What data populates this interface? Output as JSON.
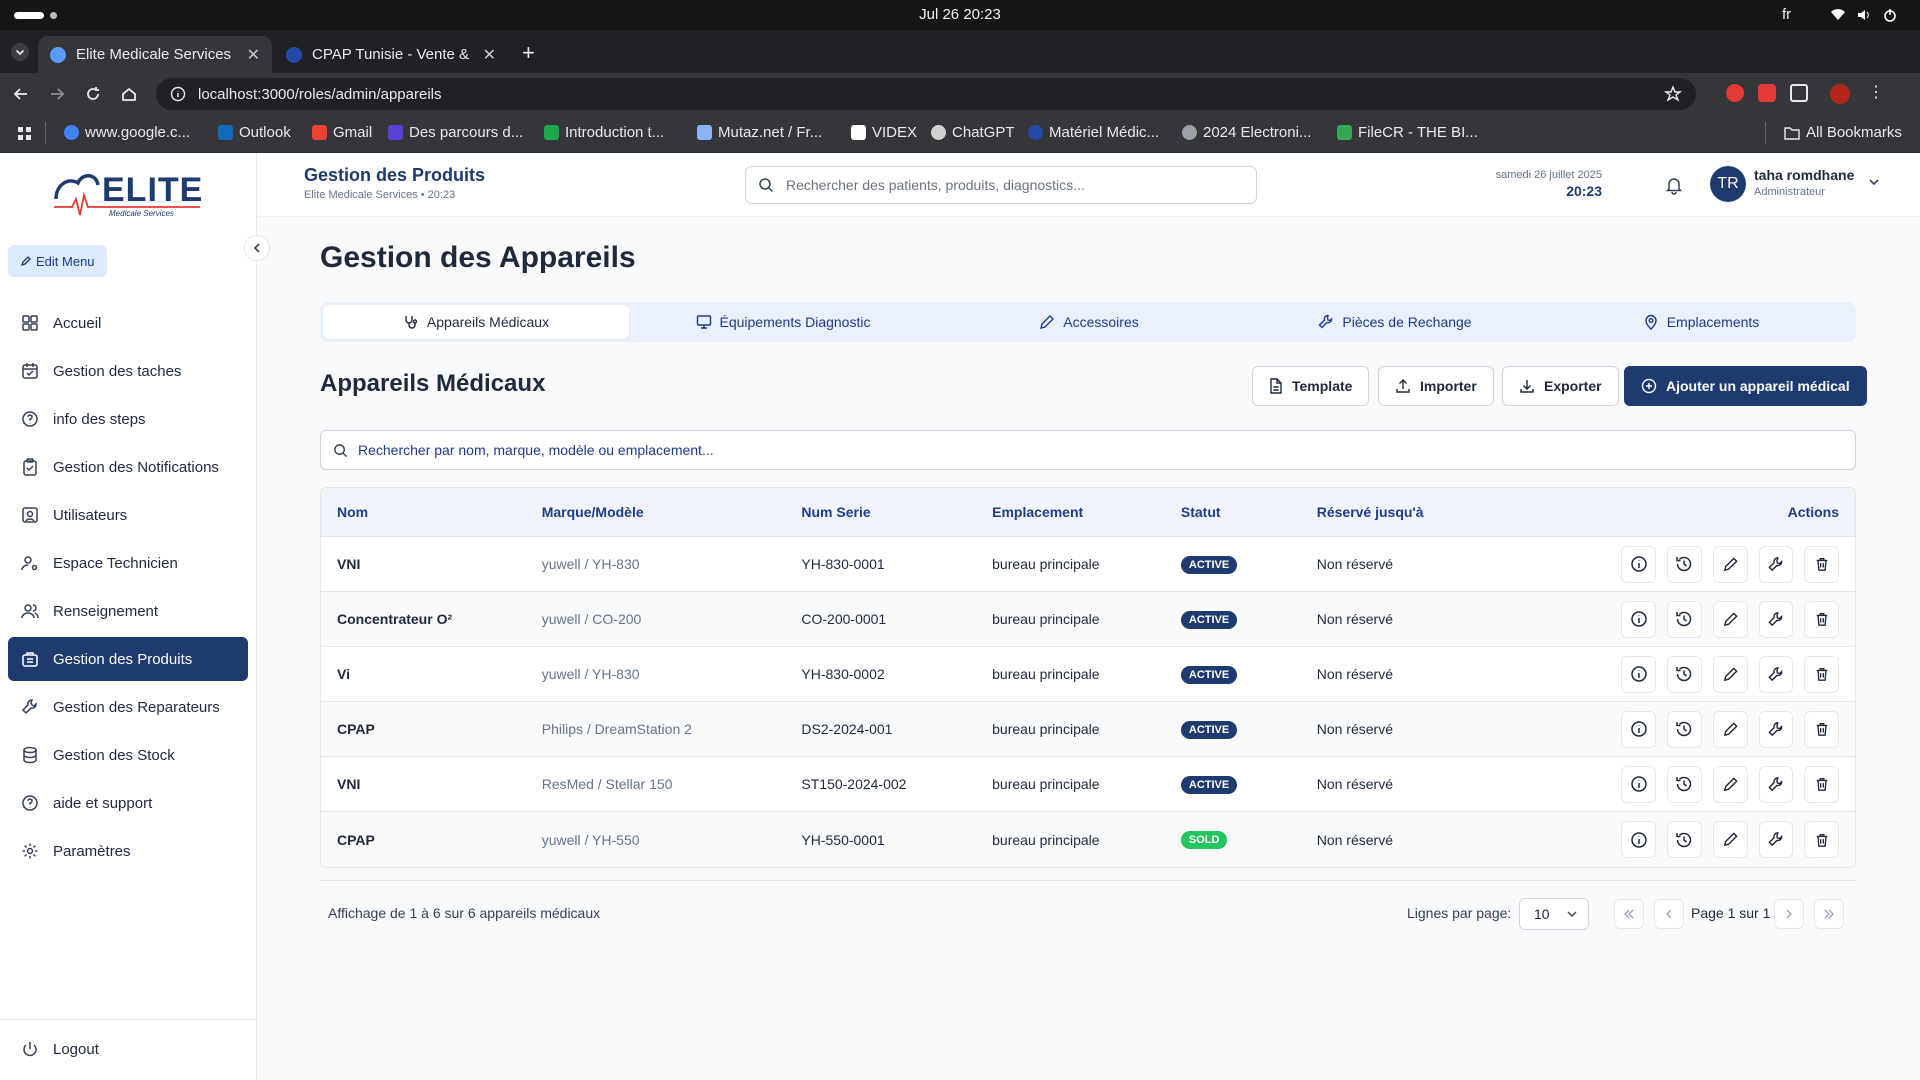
{
  "os": {
    "clock": "Jul 26  20:23",
    "lang": "fr"
  },
  "browser": {
    "tabs": [
      {
        "title": "Elite Medicale Services | "
      },
      {
        "title": "CPAP Tunisie - Vente & Lo"
      }
    ],
    "url": "localhost:3000/roles/admin/appareils",
    "bookmarks": [
      "www.google.c...",
      "Outlook",
      "Gmail",
      "Des parcours d...",
      "Introduction t...",
      "Mutaz.net / Fr...",
      "VIDEX",
      "ChatGPT",
      "Matériel Médic...",
      "2024 Electroni...",
      "FileCR - THE BI..."
    ],
    "all_bookmarks": "All Bookmarks"
  },
  "sidebar": {
    "logo_text": "ELITE",
    "logo_sub": "Medicale Services",
    "edit_menu": "Edit Menu",
    "items": [
      {
        "label": "Accueil",
        "icon": "grid-icon"
      },
      {
        "label": "Gestion des taches",
        "icon": "calendar-icon"
      },
      {
        "label": "info des steps",
        "icon": "help-circle-icon"
      },
      {
        "label": "Gestion des Notifications",
        "icon": "clipboard-check-icon"
      },
      {
        "label": "Utilisateurs",
        "icon": "user-square-icon"
      },
      {
        "label": "Espace Technicien",
        "icon": "user-cog-icon"
      },
      {
        "label": "Renseignement",
        "icon": "users-icon"
      },
      {
        "label": "Gestion des Produits",
        "icon": "briefcase-icon"
      },
      {
        "label": "Gestion des Reparateurs",
        "icon": "wrench-icon"
      },
      {
        "label": "Gestion des Stock",
        "icon": "database-icon"
      },
      {
        "label": "aide et support",
        "icon": "help-circle-icon"
      },
      {
        "label": "Paramètres",
        "icon": "gear-icon"
      }
    ],
    "active_index": 7,
    "logout": "Logout"
  },
  "header": {
    "title": "Gestion des Produits",
    "subtitle": "Elite Medicale Services • 20:23",
    "search_placeholder": "Rechercher des patients, produits, diagnostics...",
    "date": "samedi 26 juillet 2025",
    "time": "20:23",
    "user_initials": "TR",
    "user_name": "taha romdhane",
    "user_role": "Administrateur"
  },
  "page": {
    "title": "Gestion des Appareils",
    "tabs": [
      {
        "label": "Appareils Médicaux",
        "icon": "stethoscope-icon"
      },
      {
        "label": "Équipements Diagnostic",
        "icon": "monitor-icon"
      },
      {
        "label": "Accessoires",
        "icon": "pen-icon"
      },
      {
        "label": "Pièces de Rechange",
        "icon": "wrench-icon"
      },
      {
        "label": "Emplacements",
        "icon": "map-pin-icon"
      }
    ],
    "section_title": "Appareils Médicaux",
    "buttons": {
      "template": "Template",
      "import": "Importer",
      "export": "Exporter",
      "add": "Ajouter un appareil médical"
    },
    "search_placeholder": "Rechercher par nom, marque, modèle ou emplacement...",
    "columns": [
      "Nom",
      "Marque/Modèle",
      "Num Serie",
      "Emplacement",
      "Statut",
      "Réservé jusqu'à",
      "Actions"
    ],
    "rows": [
      {
        "nom": "VNI",
        "marque": "yuwell / YH-830",
        "serie": "YH-830-0001",
        "emplacement": "bureau principale",
        "statut": "ACTIVE",
        "reserve": "Non réservé"
      },
      {
        "nom": "Concentrateur O²",
        "marque": "yuwell / CO-200",
        "serie": "CO-200-0001",
        "emplacement": "bureau principale",
        "statut": "ACTIVE",
        "reserve": "Non réservé"
      },
      {
        "nom": "Vi",
        "marque": "yuwell / YH-830",
        "serie": "YH-830-0002",
        "emplacement": "bureau principale",
        "statut": "ACTIVE",
        "reserve": "Non réservé"
      },
      {
        "nom": "CPAP",
        "marque": "Philips / DreamStation 2",
        "serie": "DS2-2024-001",
        "emplacement": "bureau principale",
        "statut": "ACTIVE",
        "reserve": "Non réservé"
      },
      {
        "nom": "VNI",
        "marque": "ResMed / Stellar 150",
        "serie": "ST150-2024-002",
        "emplacement": "bureau principale",
        "statut": "ACTIVE",
        "reserve": "Non réservé"
      },
      {
        "nom": "CPAP",
        "marque": "yuwell / YH-550",
        "serie": "YH-550-0001",
        "emplacement": "bureau principale",
        "statut": "SOLD",
        "reserve": "Non réservé"
      }
    ],
    "footer": {
      "info": "Affichage de 1 à 6 sur 6 appareils médicaux",
      "rows_per_page_label": "Lignes par page:",
      "rows_per_page": "10",
      "page_text": "Page 1 sur 1"
    }
  },
  "colors": {
    "primary": "#1e3a6e",
    "active_badge": "#1e3a6e",
    "sold_badge": "#22c55e",
    "tab_bg": "#eaf1fb"
  }
}
